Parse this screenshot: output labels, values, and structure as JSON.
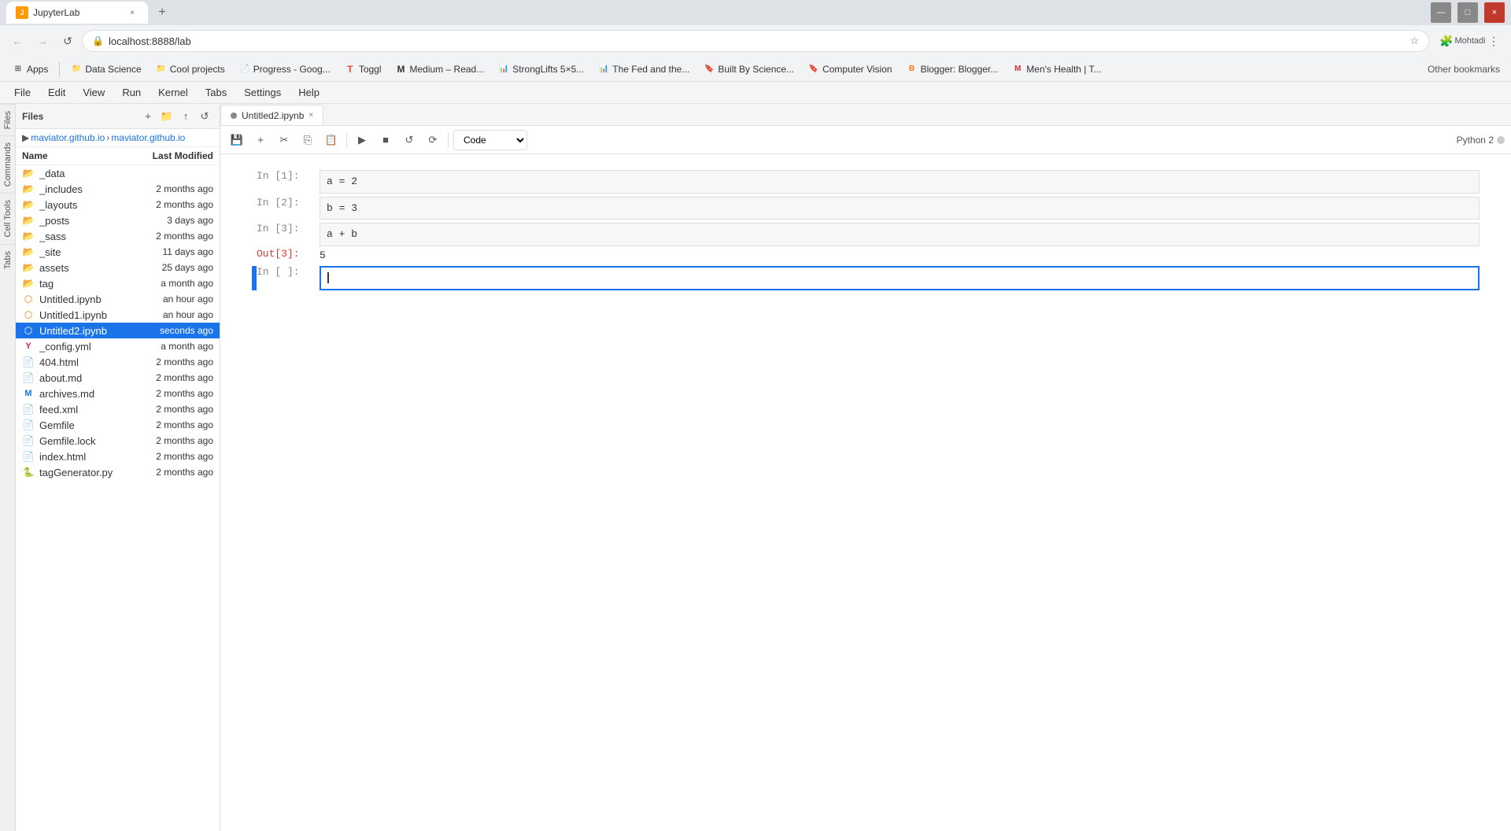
{
  "browser": {
    "tab": {
      "favicon": "J",
      "title": "JupyterLab",
      "url": "localhost:8888/lab"
    },
    "bookmarks": [
      {
        "id": "apps",
        "label": "Apps",
        "icon": "★"
      },
      {
        "id": "data-science",
        "label": "Data Science",
        "icon": "📁"
      },
      {
        "id": "cool-projects",
        "label": "Cool projects",
        "icon": "📁"
      },
      {
        "id": "progress-goog",
        "label": "Progress - Goog...",
        "icon": "📄"
      },
      {
        "id": "toggl",
        "label": "Toggl",
        "icon": "T"
      },
      {
        "id": "medium",
        "label": "Medium – Read...",
        "icon": "M"
      },
      {
        "id": "stronglifts",
        "label": "StrongLifts 5×5...",
        "icon": "📊"
      },
      {
        "id": "the-fed",
        "label": "The Fed and the...",
        "icon": "📊"
      },
      {
        "id": "built-by-science",
        "label": "Built By Science...",
        "icon": "🔖"
      },
      {
        "id": "computer-vision",
        "label": "Computer Vision",
        "icon": "🔖"
      },
      {
        "id": "blogger",
        "label": "Blogger: Blogger...",
        "icon": "B"
      },
      {
        "id": "mens-health",
        "label": "Men's Health | T...",
        "icon": "M"
      }
    ],
    "other_bookmarks": "Other bookmarks"
  },
  "jupyter": {
    "menu": [
      "File",
      "Edit",
      "View",
      "Run",
      "Kernel",
      "Tabs",
      "Settings",
      "Help"
    ],
    "breadcrumb": {
      "root": "maviator.github.io",
      "child": "maviator.github.io"
    },
    "file_panel": {
      "header": "Files",
      "columns": {
        "name": "Name",
        "modified": "Last Modified"
      },
      "files": [
        {
          "name": "_data",
          "type": "folder",
          "modified": ""
        },
        {
          "name": "_includes",
          "type": "folder",
          "modified": "2 months ago"
        },
        {
          "name": "_layouts",
          "type": "folder",
          "modified": "2 months ago"
        },
        {
          "name": "_posts",
          "type": "folder",
          "modified": "3 days ago"
        },
        {
          "name": "_sass",
          "type": "folder",
          "modified": "2 months ago"
        },
        {
          "name": "_site",
          "type": "folder",
          "modified": "11 days ago"
        },
        {
          "name": "assets",
          "type": "folder",
          "modified": "25 days ago"
        },
        {
          "name": "tag",
          "type": "folder",
          "modified": "a month ago"
        },
        {
          "name": "Untitled.ipynb",
          "type": "ipynb",
          "modified": "an hour ago"
        },
        {
          "name": "Untitled1.ipynb",
          "type": "ipynb",
          "modified": "an hour ago"
        },
        {
          "name": "Untitled2.ipynb",
          "type": "ipynb",
          "modified": "seconds ago",
          "selected": true
        },
        {
          "name": "_config.yml",
          "type": "yaml",
          "modified": "a month ago"
        },
        {
          "name": "404.html",
          "type": "html",
          "modified": "2 months ago"
        },
        {
          "name": "about.md",
          "type": "md",
          "modified": "2 months ago"
        },
        {
          "name": "archives.md",
          "type": "md",
          "modified": "2 months ago"
        },
        {
          "name": "feed.xml",
          "type": "xml",
          "modified": "2 months ago"
        },
        {
          "name": "Gemfile",
          "type": "file",
          "modified": "2 months ago"
        },
        {
          "name": "Gemfile.lock",
          "type": "file",
          "modified": "2 months ago"
        },
        {
          "name": "index.html",
          "type": "html",
          "modified": "2 months ago"
        },
        {
          "name": "tagGenerator.py",
          "type": "py",
          "modified": "2 months ago"
        }
      ]
    },
    "notebook": {
      "tab_title": "Untitled2.ipynb",
      "kernel": "Python 2",
      "cells": [
        {
          "id": "c1",
          "type": "code",
          "prompt_in": "In [1]:",
          "code": "a = 2"
        },
        {
          "id": "c2",
          "type": "code",
          "prompt_in": "In [2]:",
          "code": "b = 3"
        },
        {
          "id": "c3",
          "type": "code",
          "prompt_in": "In [3]:",
          "code": "a + b",
          "output_prompt": "Out[3]:",
          "output": "5"
        },
        {
          "id": "c4",
          "type": "code",
          "prompt_in": "In [ ]:",
          "code": "",
          "active": true
        }
      ]
    },
    "toolbar_buttons": {
      "save": "💾",
      "add_cell": "+",
      "cut": "✂",
      "copy": "⎘",
      "paste": "📋",
      "run": "▶",
      "stop": "■",
      "restart": "↺",
      "restart_run": "⟳",
      "cell_type": "Code"
    },
    "vert_tabs": [
      "Files",
      "Commands",
      "Cell Tools",
      "Tabs"
    ]
  }
}
